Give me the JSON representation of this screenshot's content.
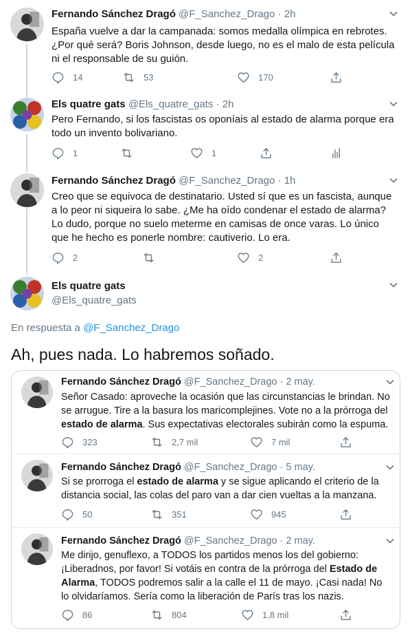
{
  "tweets": [
    {
      "name": "Fernando Sánchez Dragó",
      "handle": "@F_Sanchez_Drago",
      "sep": "·",
      "time": "2h",
      "text": "España vuelve a dar la campanada: somos medalla olímpica en rebrotes. ¿Por qué será? Boris Johnson, desde luego, no es el malo de esta película ni el responsable de su guión.",
      "replies": "14",
      "retweets": "53",
      "likes": "170"
    },
    {
      "name": "Els quatre gats",
      "handle": "@Els_quatre_gats",
      "sep": "·",
      "time": "2h",
      "text": "Pero Fernando, si los fascistas os oponíais al estado de alarma porque era todo un invento bolivariano.",
      "replies": "1",
      "retweets": "",
      "likes": "1"
    },
    {
      "name": "Fernando Sánchez Dragó",
      "handle": "@F_Sanchez_Drago",
      "sep": "·",
      "time": "1h",
      "text": "Creo que se equivoca de destinatario. Usted sí que es un fascista, aunque a lo peor ni siqueira lo sabe. ¿Me ha oído condenar el estado de alarma? Lo dudo, porque no suelo meterme en camisas de once varas. Lo único que he hecho es ponerle nombre: cautiverio. Lo era.",
      "replies": "2",
      "retweets": "",
      "likes": "2"
    }
  ],
  "focused": {
    "name": "Els quatre gats",
    "handle": "@Els_quatre_gats",
    "reply_prefix": "En respuesta a",
    "reply_handle": "@F_Sanchez_Drago",
    "text": "Ah, pues nada. Lo habremos soñado."
  },
  "quoted": [
    {
      "name": "Fernando Sánchez Dragó",
      "handle": "@F_Sanchez_Drago",
      "sep": "·",
      "time": "2 may.",
      "t1": "Señor Casado: aproveche la ocasión que las circunstancias le brindan. No se arrugue. Tire a la basura los maricomplejines.  Vote no a la prórroga del ",
      "bold": "estado de alarma",
      "t2": ". Sus expectativas electorales subirán como la espuma.",
      "replies": "323",
      "retweets": "2,7 mil",
      "likes": "7 mil"
    },
    {
      "name": "Fernando Sánchez Dragó",
      "handle": "@F_Sanchez_Drago",
      "sep": "·",
      "time": "5 may.",
      "t1": "Si se prorroga el ",
      "bold": "estado de alarma",
      "t2": " y se sigue aplicando el criterio de la distancia social, las colas del paro van a dar cien vueltas a la manzana.",
      "replies": "50",
      "retweets": "351",
      "likes": "945"
    },
    {
      "name": "Fernando Sánchez Dragó",
      "handle": "@F_Sanchez_Drago",
      "sep": "·",
      "time": "2 may.",
      "t1": "Me dirijo, genuflexo, a TODOS los partidos menos los del gobierno: ¡Liberadnos, por favor! Si votáis en contra de la prórroga del ",
      "bold": "Estado de Alarma",
      "t2": ", TODOS podremos salir a la calle el 11 de mayo. ¡Casi nada! No lo olvidaríamos. Sería como la liberación de París tras los nazis.",
      "replies": "86",
      "retweets": "804",
      "likes": "1,8 mil"
    }
  ],
  "icons": {
    "reply": "reply-icon",
    "retweet": "retweet-icon",
    "like": "heart-icon",
    "share": "share-icon",
    "analytics": "analytics-icon",
    "menu": "chevron-down-icon"
  },
  "colors": {
    "link": "#1b95e0",
    "muted": "#657786",
    "border": "#ccd6dd",
    "text": "#14171a"
  }
}
